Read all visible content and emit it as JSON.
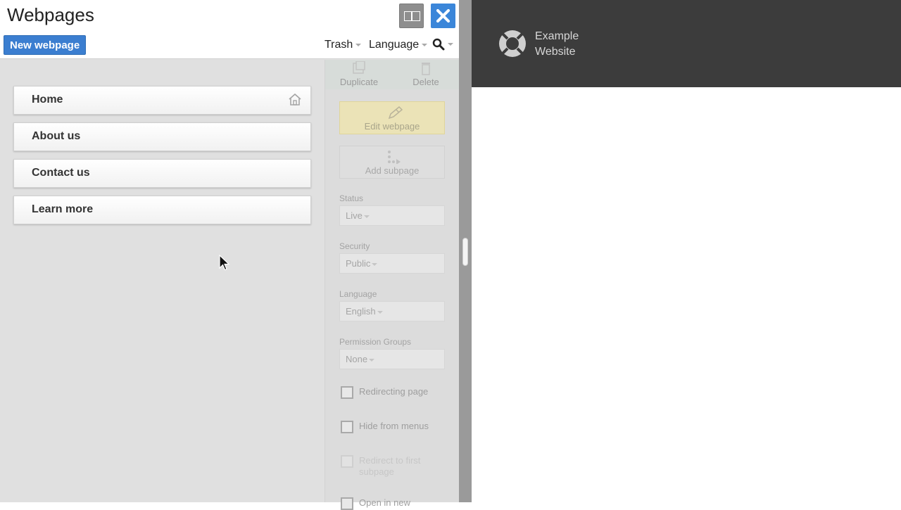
{
  "panel": {
    "title": "Webpages",
    "new_button": "New webpage",
    "menus": {
      "trash": "Trash",
      "language": "Language"
    },
    "icons": {
      "layout_toggle": "split-layout-icon",
      "close": "close-icon",
      "search": "search-icon"
    }
  },
  "tree": {
    "items": [
      {
        "label": "Home",
        "icon": "home-icon"
      },
      {
        "label": "About us"
      },
      {
        "label": "Contact us"
      },
      {
        "label": "Learn more"
      }
    ]
  },
  "properties": {
    "duplicate": "Duplicate",
    "delete": "Delete",
    "edit_webpage": "Edit webpage",
    "add_subpage": "Add subpage",
    "status": {
      "label": "Status",
      "value": "Live"
    },
    "security": {
      "label": "Security",
      "value": "Public"
    },
    "language": {
      "label": "Language",
      "value": "English"
    },
    "permission_groups": {
      "label": "Permission Groups",
      "value": "None"
    },
    "checkboxes": [
      {
        "label": "Redirecting page",
        "checked": false,
        "enabled": true
      },
      {
        "label": "Hide from menus",
        "checked": false,
        "enabled": true
      },
      {
        "label": "Redirect to first subpage",
        "checked": false,
        "enabled": false
      },
      {
        "label": "Open in new",
        "checked": false,
        "enabled": true
      }
    ]
  },
  "preview": {
    "site_name_line1": "Example",
    "site_name_line2": "Website",
    "logo_icon": "lifebuoy-icon"
  },
  "colors": {
    "accent": "#3b7ed0",
    "edit_button_bg": "#ebe3b7",
    "site_header_bg": "#3c3c3c"
  }
}
